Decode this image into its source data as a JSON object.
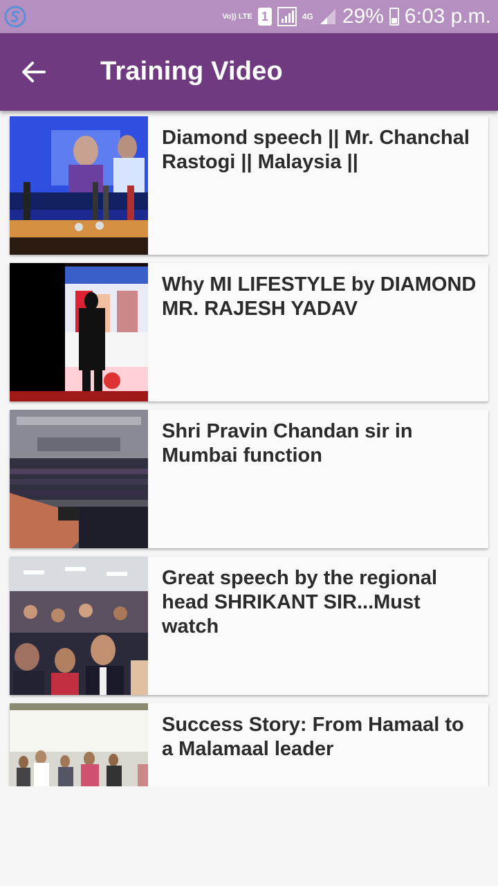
{
  "status_bar": {
    "volte": "Vo)) LTE",
    "sim": "1",
    "network": "4G",
    "battery": "29%",
    "time": "6:03 p.m."
  },
  "app_bar": {
    "title": "Training Video",
    "back_icon": "arrow-left-icon"
  },
  "videos": [
    {
      "title": "Diamond speech || Mr. Chanchal Rastogi || Malaysia ||"
    },
    {
      "title": "Why MI LIFESTYLE by DIAMOND MR. RAJESH YADAV"
    },
    {
      "title": "Shri Pravin Chandan sir in Mumbai function"
    },
    {
      "title": "Great speech by the regional head SHRIKANT SIR...Must watch"
    },
    {
      "title": "Success Story: From Hamaal to a Malamaal leader"
    }
  ],
  "colors": {
    "status_bar": "#b48fc0",
    "app_bar": "#6f3a80",
    "background": "#f5f5f5"
  }
}
